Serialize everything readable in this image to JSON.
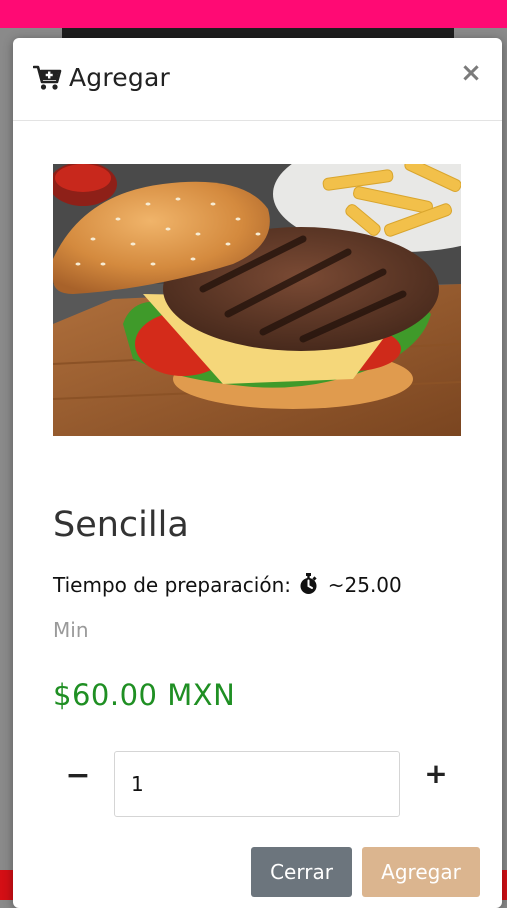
{
  "modal": {
    "title": "Agregar",
    "close_symbol": "×",
    "cart_icon": "cart-plus-icon"
  },
  "product": {
    "image_alt": "Hamburguesa",
    "name": "Sencilla",
    "prep_label": "Tiempo de preparación:",
    "timer_icon": "stopwatch-icon",
    "prep_time": "~25.00",
    "prep_unit": "Min",
    "price": "$60.00 MXN"
  },
  "quantity": {
    "minus_symbol": "−",
    "value": "1",
    "plus_symbol": "+"
  },
  "buttons": {
    "close_label": "Cerrar",
    "add_label": "Agregar"
  },
  "colors": {
    "topbar": "#ff0a74",
    "price": "#1f8f23",
    "close_button": "#6c757d",
    "add_button": "#dbb58f"
  }
}
